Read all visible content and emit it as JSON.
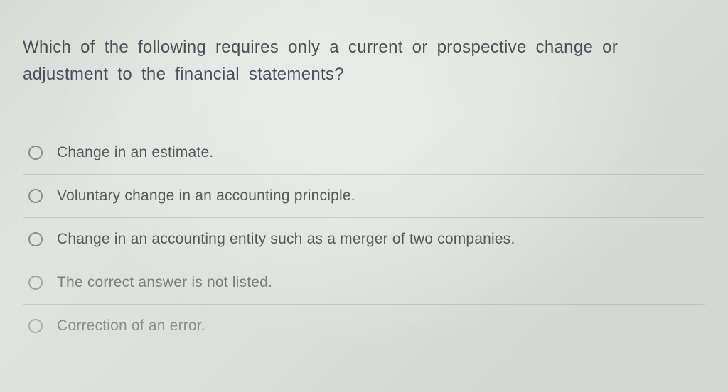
{
  "question": {
    "text": "Which of the following requires only a current or prospective change or adjustment to the financial statements?"
  },
  "options": [
    {
      "label": "Change in an estimate."
    },
    {
      "label": "Voluntary change in an accounting principle."
    },
    {
      "label": "Change in an accounting entity such as a merger of two companies."
    },
    {
      "label": "The correct answer is not listed."
    },
    {
      "label": "Correction of an error."
    }
  ]
}
